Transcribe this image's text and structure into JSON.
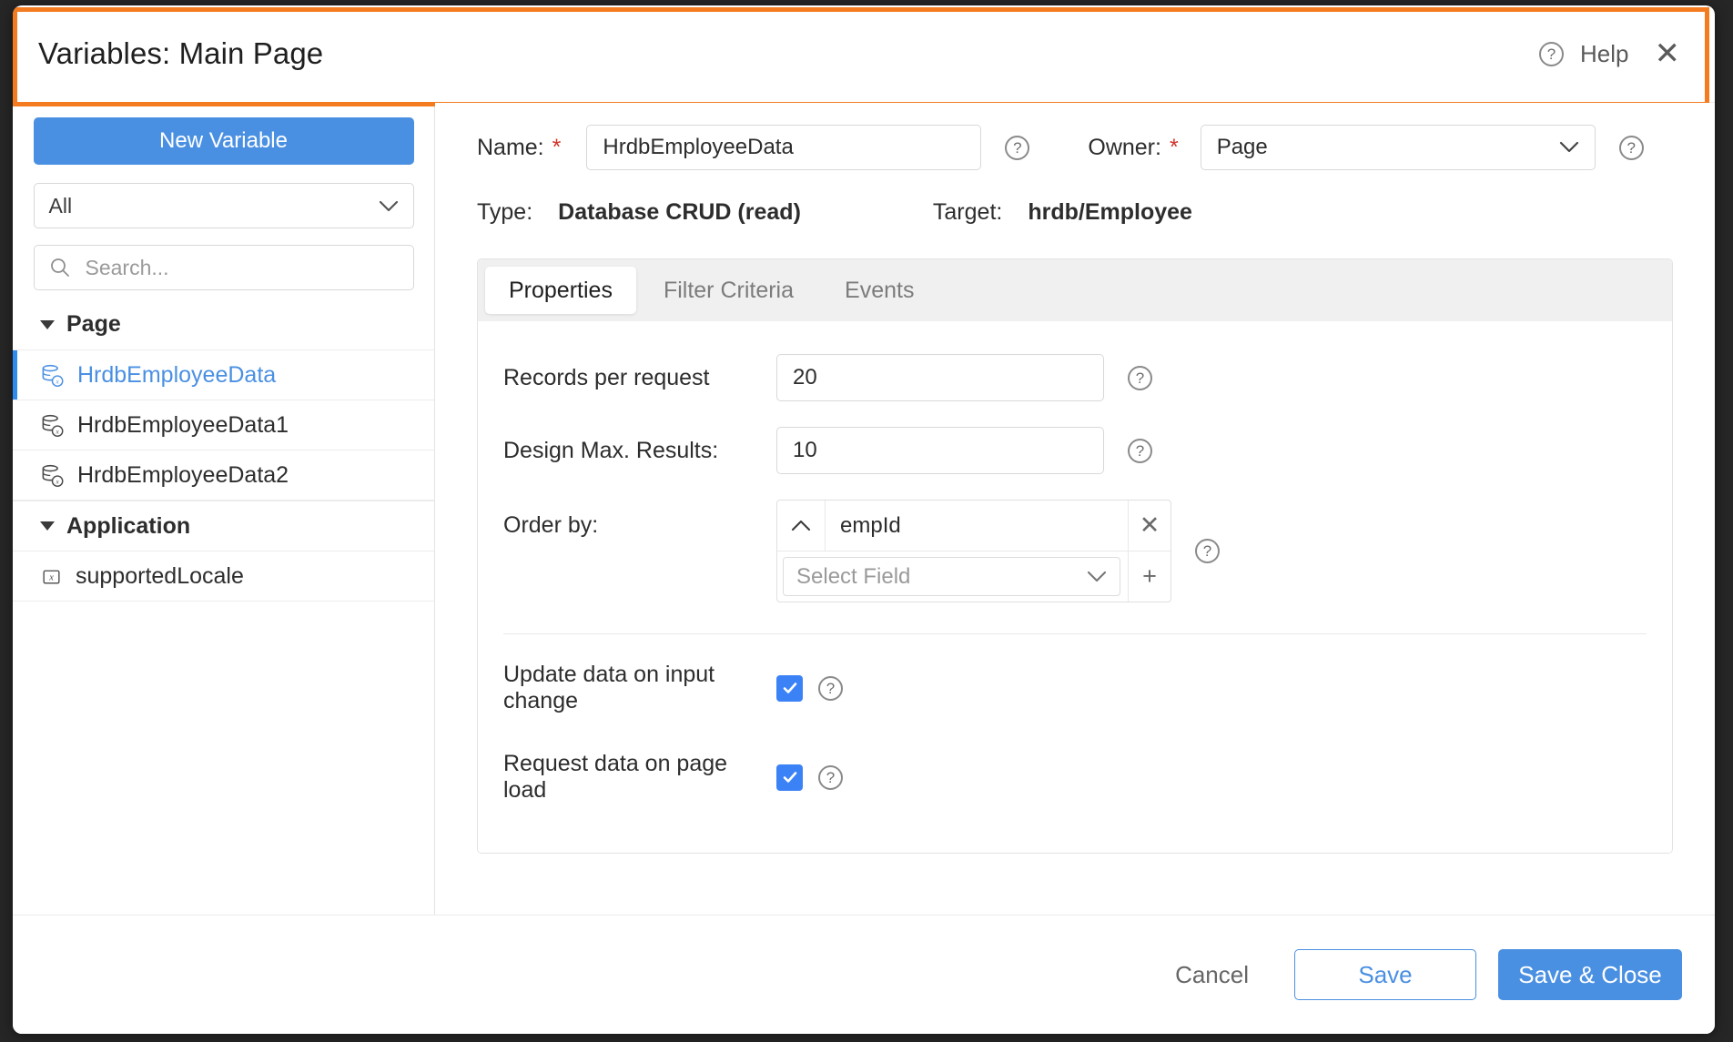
{
  "header": {
    "title": "Variables: Main Page",
    "help_label": "Help",
    "help_icon": "question-circle-icon",
    "close_icon": "close-icon",
    "highlight_color": "#f47b20"
  },
  "sidebar": {
    "new_variable_label": "New Variable",
    "filter_value": "All",
    "search_placeholder": "Search...",
    "groups": [
      {
        "label": "Page",
        "items": [
          {
            "label": "HrdbEmployeeData",
            "icon": "database-variable-icon",
            "selected": true
          },
          {
            "label": "HrdbEmployeeData1",
            "icon": "database-variable-icon",
            "selected": false
          },
          {
            "label": "HrdbEmployeeData2",
            "icon": "database-variable-icon",
            "selected": false
          }
        ]
      },
      {
        "label": "Application",
        "items": [
          {
            "label": "supportedLocale",
            "icon": "variable-x-icon",
            "selected": false
          }
        ]
      }
    ]
  },
  "main": {
    "name_label": "Name:",
    "name_value": "HrdbEmployeeData",
    "owner_label": "Owner:",
    "owner_value": "Page",
    "type_label": "Type:",
    "type_value": "Database CRUD (read)",
    "target_label": "Target:",
    "target_value": "hrdb/Employee",
    "required_marker": "*",
    "tabs": [
      {
        "label": "Properties",
        "active": true
      },
      {
        "label": "Filter Criteria",
        "active": false
      },
      {
        "label": "Events",
        "active": false
      }
    ],
    "properties": {
      "records_per_request_label": "Records per request",
      "records_per_request_value": "20",
      "design_max_results_label": "Design Max. Results:",
      "design_max_results_value": "10",
      "order_by_label": "Order by:",
      "order_by_rows": [
        {
          "direction": "ascending",
          "field": "empId"
        }
      ],
      "order_by_select_placeholder": "Select Field",
      "add_icon": "plus-icon",
      "remove_icon": "close-icon",
      "update_on_input_change_label": "Update data on input change",
      "update_on_input_change_checked": true,
      "request_on_page_load_label": "Request data on page load",
      "request_on_page_load_checked": true
    }
  },
  "footer": {
    "cancel_label": "Cancel",
    "save_label": "Save",
    "save_close_label": "Save & Close"
  },
  "colors": {
    "accent_blue": "#4a90e2",
    "checkbox_blue": "#3b82f6",
    "highlight_orange": "#f47b20",
    "required_red": "#d0342c"
  }
}
